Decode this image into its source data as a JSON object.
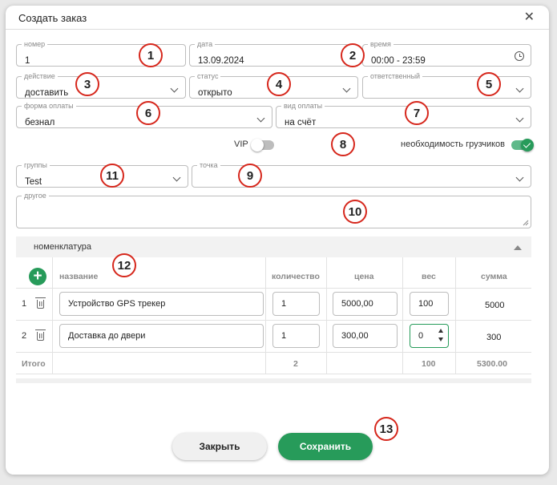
{
  "dialog": {
    "title": "Создать заказ"
  },
  "fields": {
    "number": {
      "label": "номер",
      "value": "1"
    },
    "date": {
      "label": "дата",
      "value": "13.09.2024"
    },
    "time": {
      "label": "время",
      "value": "00:00 - 23:59"
    },
    "action": {
      "label": "действие",
      "value": "доставить"
    },
    "status": {
      "label": "статус",
      "value": "открыто"
    },
    "responsible": {
      "label": "ответственный",
      "value": ""
    },
    "payment_form": {
      "label": "форма оплаты",
      "value": "безнал"
    },
    "payment_type": {
      "label": "вид оплаты",
      "value": "на счёт"
    },
    "groups": {
      "label": "группы",
      "value": "Test"
    },
    "point": {
      "label": "точка",
      "value": ""
    },
    "other": {
      "label": "другое",
      "value": ""
    }
  },
  "toggles": {
    "vip": {
      "label": "VIP",
      "on": false
    },
    "loaders": {
      "label": "необходимость грузчиков",
      "on": true
    }
  },
  "nomenclature": {
    "title": "номенклатура",
    "columns": [
      "название",
      "количество",
      "цена",
      "вес",
      "сумма"
    ],
    "rows": [
      {
        "num": "1",
        "name": "Устройство GPS трекер",
        "qty": "1",
        "price": "5000,00",
        "weight": "100",
        "sum": "5000"
      },
      {
        "num": "2",
        "name": "Доставка до двери",
        "qty": "1",
        "price": "300,00",
        "weight": "0",
        "sum": "300"
      }
    ],
    "totals": {
      "label": "Итого",
      "qty": "2",
      "weight": "100",
      "sum": "5300.00"
    }
  },
  "buttons": {
    "close": "Закрыть",
    "save": "Сохранить"
  },
  "badges": [
    "1",
    "2",
    "3",
    "4",
    "5",
    "6",
    "7",
    "8",
    "9",
    "10",
    "11",
    "12",
    "13"
  ],
  "colors": {
    "accent": "#279b5a",
    "badge_ring": "#d6271c"
  }
}
